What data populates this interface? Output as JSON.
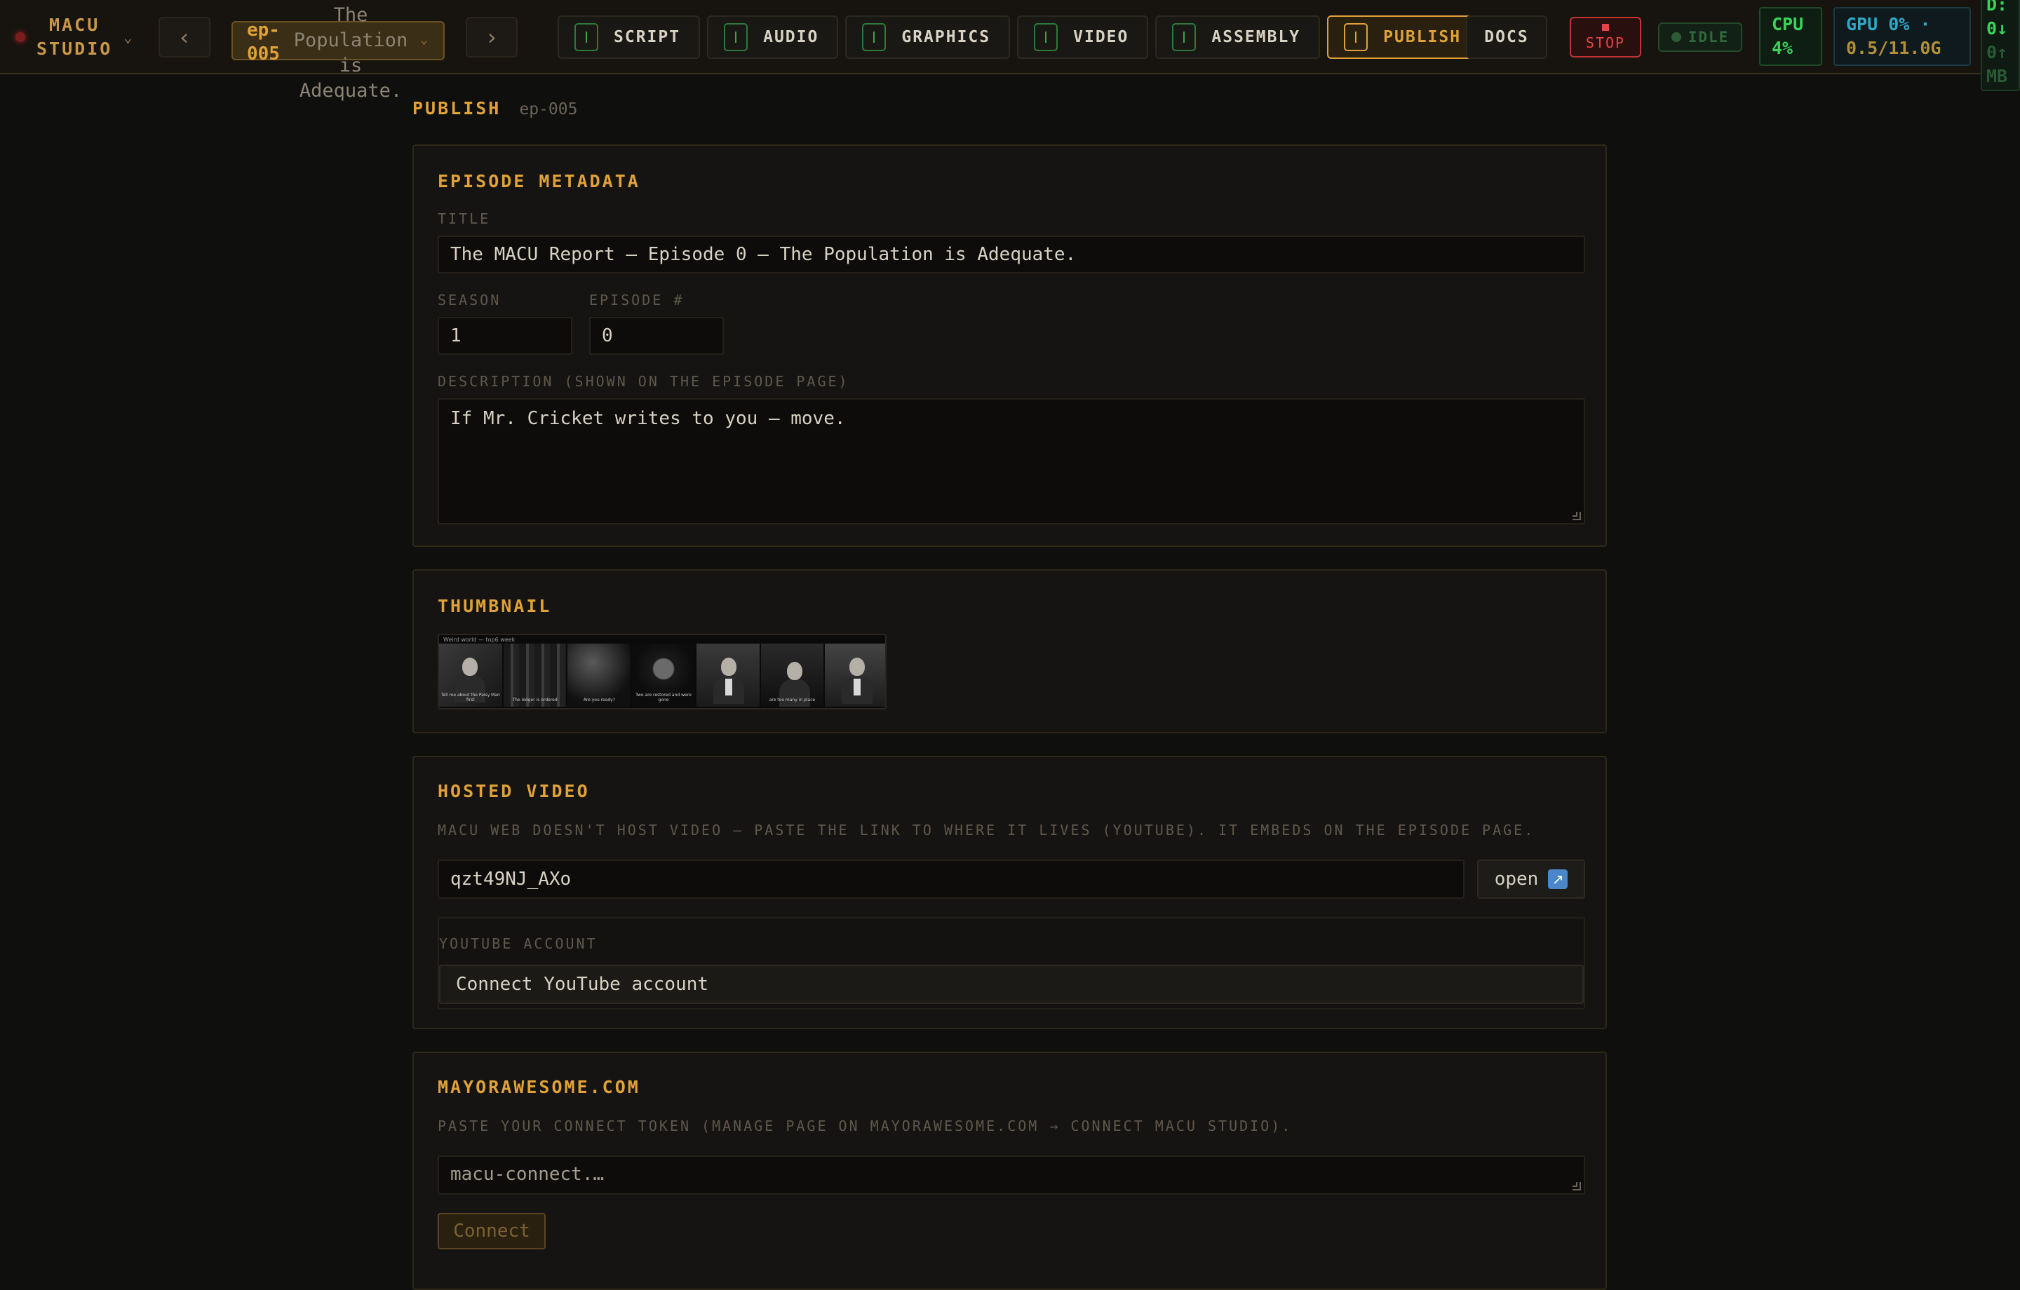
{
  "topbar": {
    "brand_line1": "MACU",
    "brand_line2": "STUDIO",
    "brand_caret": "⌄",
    "prev_arrow": "‹",
    "next_arrow": "›",
    "episode_id": "ep-005",
    "episode_title": "The Population is Adequate.",
    "episode_caret": "⌄",
    "tabs": [
      {
        "label": "SCRIPT",
        "icon": "script-icon"
      },
      {
        "label": "AUDIO",
        "icon": "audio-icon"
      },
      {
        "label": "GRAPHICS",
        "icon": "graphics-icon"
      },
      {
        "label": "VIDEO",
        "icon": "video-icon"
      },
      {
        "label": "ASSEMBLY",
        "icon": "assembly-icon"
      },
      {
        "label": "PUBLISH",
        "icon": "publish-icon",
        "active": true
      }
    ],
    "docs_label": "DOCS",
    "stop_label": "STOP",
    "status_label": "IDLE",
    "cpu_label": "CPU",
    "cpu_value": "4%",
    "gpu_line1": "GPU 0% ·",
    "gpu_line2": "0.5/11.0G",
    "disk_line1": "D:",
    "disk_line2": "0↓",
    "disk_line3": "0↑",
    "disk_line4": "MB"
  },
  "page": {
    "title": "PUBLISH",
    "episode_ref": "ep-005"
  },
  "metadata": {
    "section_title": "EPISODE METADATA",
    "title_label": "TITLE",
    "title_value": "The MACU Report — Episode 0 — The Population is Adequate.",
    "season_label": "SEASON",
    "season_value": "1",
    "episode_label": "EPISODE #",
    "episode_value": "0",
    "description_label": "DESCRIPTION (SHOWN ON THE EPISODE PAGE)",
    "description_value": "If Mr. Cricket writes to you — move."
  },
  "thumbnail": {
    "section_title": "THUMBNAIL",
    "strip_header": "Weird world — top6 week",
    "captions": [
      "Tell me about the Paisy Man first",
      "The ledger is ordered",
      "Are you ready?",
      "Two are restored and were gone",
      "",
      "are too many in place",
      ""
    ]
  },
  "hosted_video": {
    "section_title": "HOSTED VIDEO",
    "hint": "MACU WEB DOESN'T HOST VIDEO — PASTE THE LINK TO WHERE IT LIVES (YOUTUBE). IT EMBEDS ON THE EPISODE PAGE.",
    "video_id_value": "qzt49NJ_AXo",
    "open_label": "open",
    "youtube_label": "YOUTUBE ACCOUNT",
    "youtube_connect_label": "Connect YouTube account"
  },
  "mayorawesome": {
    "section_title": "MAYORAWESOME.COM",
    "hint": "PASTE YOUR CONNECT TOKEN (MANAGE PAGE ON MAYORAWESOME.COM → CONNECT MACU STUDIO).",
    "token_placeholder": "macu-connect.…",
    "connect_label": "Connect"
  },
  "colors": {
    "accent": "#e0a238",
    "background": "#0f0f0e",
    "panel": "#161412",
    "stop": "#e04646",
    "cpu": "#3ad25a",
    "gpu": "#2fa8c8"
  }
}
